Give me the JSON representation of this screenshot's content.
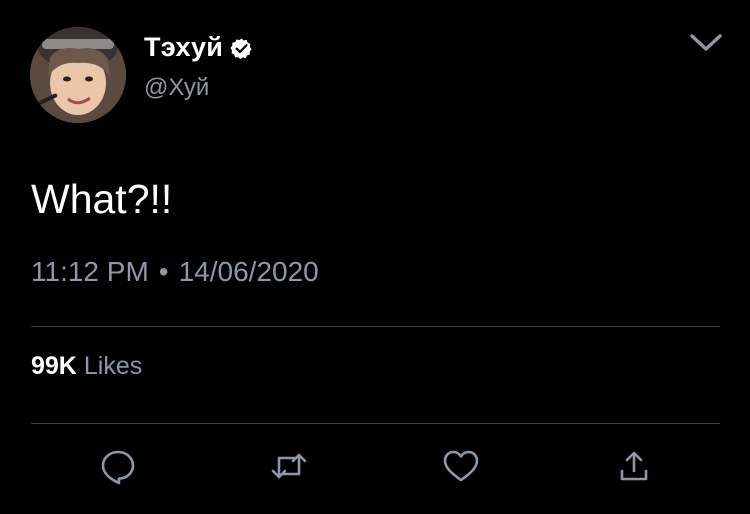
{
  "tweet": {
    "display_name": "Тэхуй",
    "handle": "@Хуй",
    "verified_icon": "verified-badge-icon",
    "text": "What?!!",
    "time": "11:12 PM",
    "separator": "•",
    "date": "14/06/2020",
    "likes_count": "99K",
    "likes_label": "Likes"
  },
  "icons": {
    "menu": "chevron-down-icon",
    "reply": "reply-icon",
    "retweet": "retweet-icon",
    "like": "heart-icon",
    "share": "share-icon"
  },
  "colors": {
    "background": "#000000",
    "primary_text": "#ffffff",
    "secondary_text": "#8b98a5",
    "divider": "#38444d",
    "icon": "#8b98a5"
  }
}
